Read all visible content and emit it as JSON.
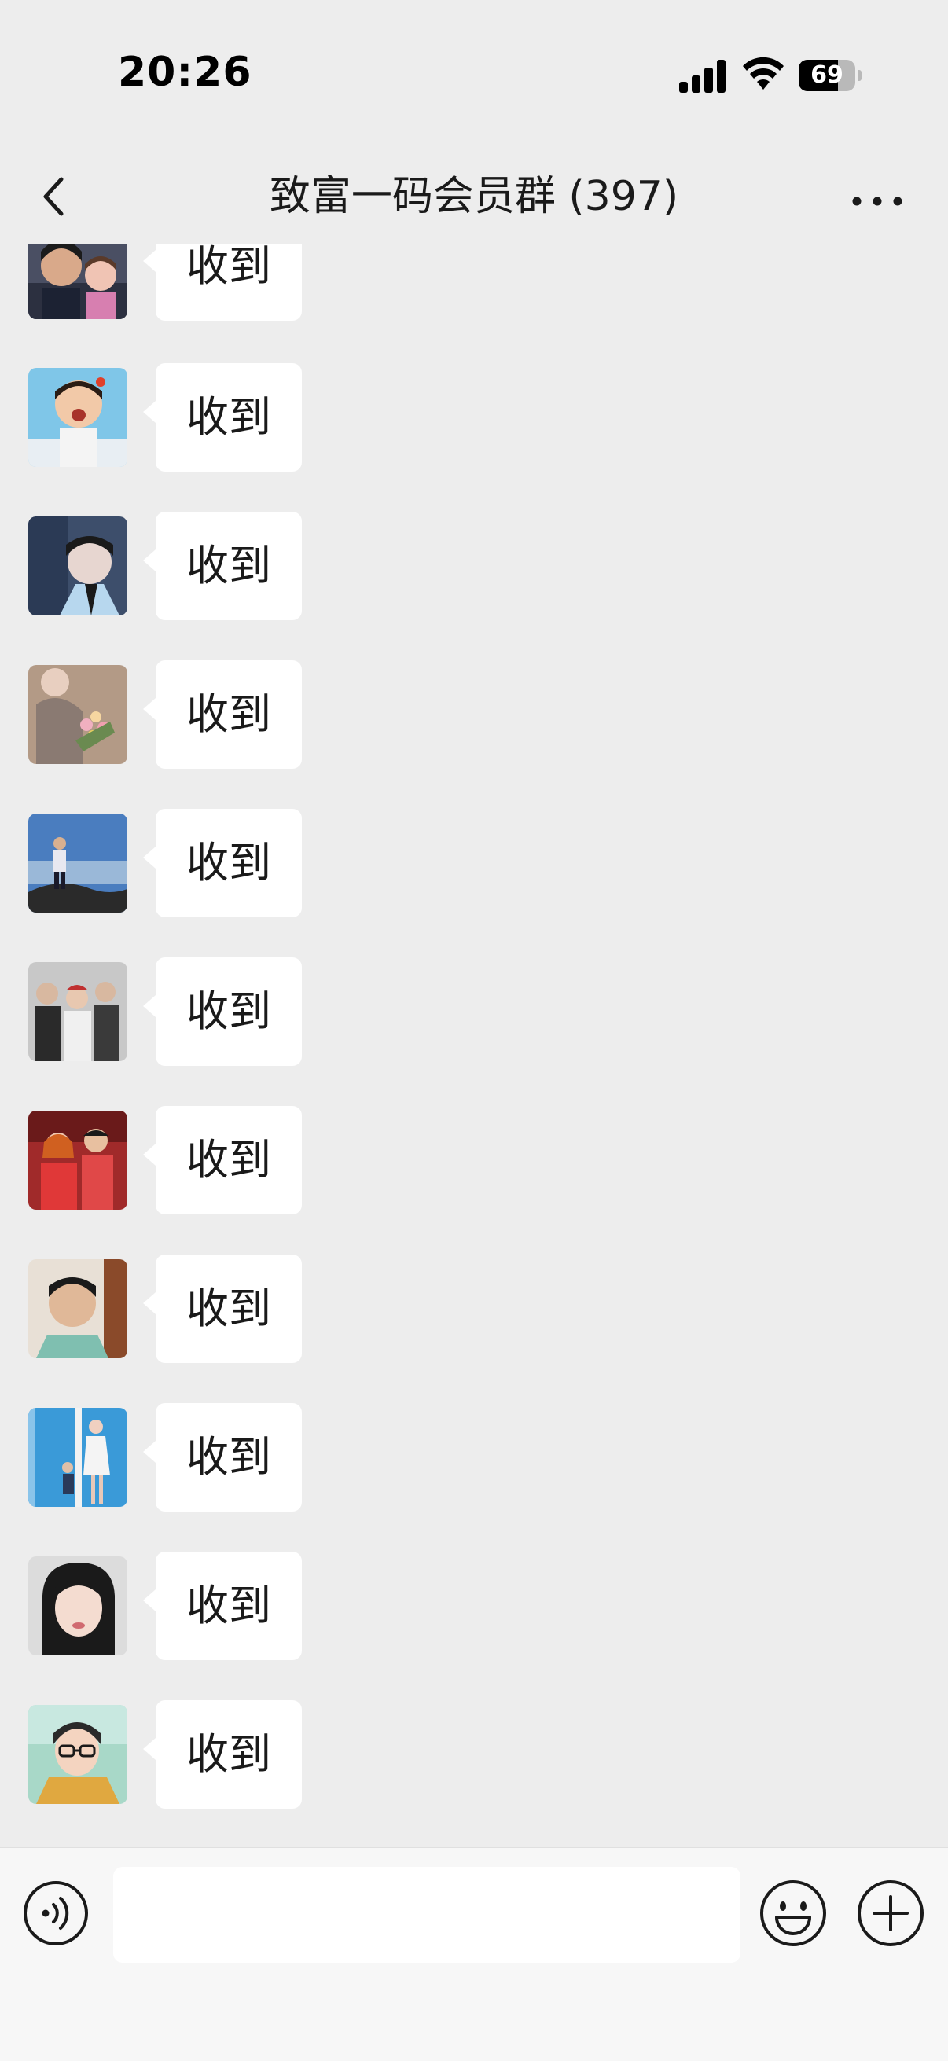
{
  "status_bar": {
    "time": "20:26",
    "battery_level": "69",
    "battery_fraction": 0.69
  },
  "header": {
    "title": "致富一码会员群 (397)",
    "back_icon": "chevron-left-icon",
    "more_icon": "more-dots-icon"
  },
  "messages": [
    {
      "text": "收到",
      "avatar": "avatar-man-with-child"
    },
    {
      "text": "收到",
      "avatar": "avatar-toddler-girl"
    },
    {
      "text": "收到",
      "avatar": "avatar-young-man-blue"
    },
    {
      "text": "收到",
      "avatar": "avatar-woman-with-flowers"
    },
    {
      "text": "收到",
      "avatar": "avatar-man-on-mountain"
    },
    {
      "text": "收到",
      "avatar": "avatar-three-friends"
    },
    {
      "text": "收到",
      "avatar": "avatar-couple-red-wedding"
    },
    {
      "text": "收到",
      "avatar": "avatar-young-man-selfie"
    },
    {
      "text": "收到",
      "avatar": "avatar-woman-and-child-blue-door"
    },
    {
      "text": "收到",
      "avatar": "avatar-woman-portrait"
    },
    {
      "text": "收到",
      "avatar": "avatar-cartoon-man-glasses"
    }
  ],
  "input_bar": {
    "placeholder": "",
    "value": "",
    "voice_icon": "voice-icon",
    "emoji_icon": "emoji-icon",
    "plus_icon": "plus-icon"
  },
  "colors": {
    "background": "#ededed",
    "bubble": "#ffffff",
    "text": "#1a1a1a",
    "input_bar": "#f7f7f7"
  }
}
